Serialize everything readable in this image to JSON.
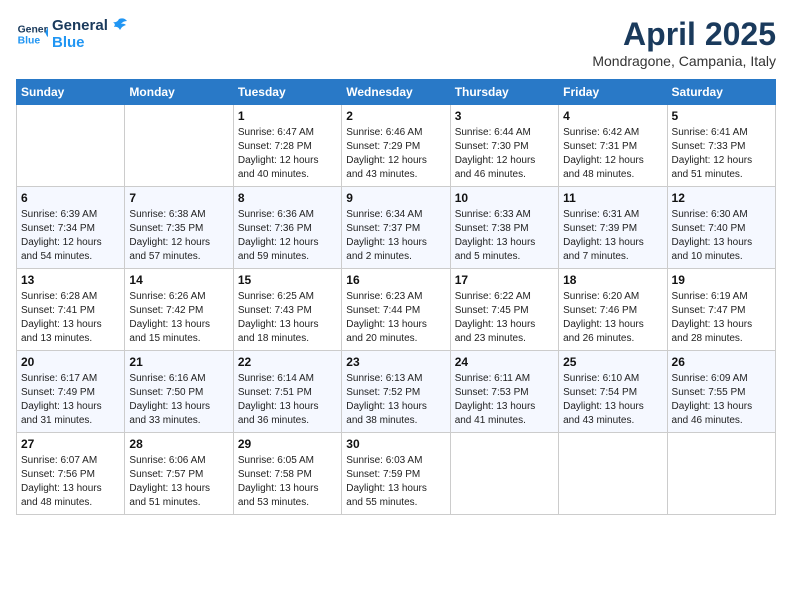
{
  "logo": {
    "line1": "General",
    "line2": "Blue"
  },
  "title": "April 2025",
  "subtitle": "Mondragone, Campania, Italy",
  "weekdays": [
    "Sunday",
    "Monday",
    "Tuesday",
    "Wednesday",
    "Thursday",
    "Friday",
    "Saturday"
  ],
  "weeks": [
    [
      {
        "day": "",
        "text": ""
      },
      {
        "day": "",
        "text": ""
      },
      {
        "day": "1",
        "text": "Sunrise: 6:47 AM\nSunset: 7:28 PM\nDaylight: 12 hours and 40 minutes."
      },
      {
        "day": "2",
        "text": "Sunrise: 6:46 AM\nSunset: 7:29 PM\nDaylight: 12 hours and 43 minutes."
      },
      {
        "day": "3",
        "text": "Sunrise: 6:44 AM\nSunset: 7:30 PM\nDaylight: 12 hours and 46 minutes."
      },
      {
        "day": "4",
        "text": "Sunrise: 6:42 AM\nSunset: 7:31 PM\nDaylight: 12 hours and 48 minutes."
      },
      {
        "day": "5",
        "text": "Sunrise: 6:41 AM\nSunset: 7:33 PM\nDaylight: 12 hours and 51 minutes."
      }
    ],
    [
      {
        "day": "6",
        "text": "Sunrise: 6:39 AM\nSunset: 7:34 PM\nDaylight: 12 hours and 54 minutes."
      },
      {
        "day": "7",
        "text": "Sunrise: 6:38 AM\nSunset: 7:35 PM\nDaylight: 12 hours and 57 minutes."
      },
      {
        "day": "8",
        "text": "Sunrise: 6:36 AM\nSunset: 7:36 PM\nDaylight: 12 hours and 59 minutes."
      },
      {
        "day": "9",
        "text": "Sunrise: 6:34 AM\nSunset: 7:37 PM\nDaylight: 13 hours and 2 minutes."
      },
      {
        "day": "10",
        "text": "Sunrise: 6:33 AM\nSunset: 7:38 PM\nDaylight: 13 hours and 5 minutes."
      },
      {
        "day": "11",
        "text": "Sunrise: 6:31 AM\nSunset: 7:39 PM\nDaylight: 13 hours and 7 minutes."
      },
      {
        "day": "12",
        "text": "Sunrise: 6:30 AM\nSunset: 7:40 PM\nDaylight: 13 hours and 10 minutes."
      }
    ],
    [
      {
        "day": "13",
        "text": "Sunrise: 6:28 AM\nSunset: 7:41 PM\nDaylight: 13 hours and 13 minutes."
      },
      {
        "day": "14",
        "text": "Sunrise: 6:26 AM\nSunset: 7:42 PM\nDaylight: 13 hours and 15 minutes."
      },
      {
        "day": "15",
        "text": "Sunrise: 6:25 AM\nSunset: 7:43 PM\nDaylight: 13 hours and 18 minutes."
      },
      {
        "day": "16",
        "text": "Sunrise: 6:23 AM\nSunset: 7:44 PM\nDaylight: 13 hours and 20 minutes."
      },
      {
        "day": "17",
        "text": "Sunrise: 6:22 AM\nSunset: 7:45 PM\nDaylight: 13 hours and 23 minutes."
      },
      {
        "day": "18",
        "text": "Sunrise: 6:20 AM\nSunset: 7:46 PM\nDaylight: 13 hours and 26 minutes."
      },
      {
        "day": "19",
        "text": "Sunrise: 6:19 AM\nSunset: 7:47 PM\nDaylight: 13 hours and 28 minutes."
      }
    ],
    [
      {
        "day": "20",
        "text": "Sunrise: 6:17 AM\nSunset: 7:49 PM\nDaylight: 13 hours and 31 minutes."
      },
      {
        "day": "21",
        "text": "Sunrise: 6:16 AM\nSunset: 7:50 PM\nDaylight: 13 hours and 33 minutes."
      },
      {
        "day": "22",
        "text": "Sunrise: 6:14 AM\nSunset: 7:51 PM\nDaylight: 13 hours and 36 minutes."
      },
      {
        "day": "23",
        "text": "Sunrise: 6:13 AM\nSunset: 7:52 PM\nDaylight: 13 hours and 38 minutes."
      },
      {
        "day": "24",
        "text": "Sunrise: 6:11 AM\nSunset: 7:53 PM\nDaylight: 13 hours and 41 minutes."
      },
      {
        "day": "25",
        "text": "Sunrise: 6:10 AM\nSunset: 7:54 PM\nDaylight: 13 hours and 43 minutes."
      },
      {
        "day": "26",
        "text": "Sunrise: 6:09 AM\nSunset: 7:55 PM\nDaylight: 13 hours and 46 minutes."
      }
    ],
    [
      {
        "day": "27",
        "text": "Sunrise: 6:07 AM\nSunset: 7:56 PM\nDaylight: 13 hours and 48 minutes."
      },
      {
        "day": "28",
        "text": "Sunrise: 6:06 AM\nSunset: 7:57 PM\nDaylight: 13 hours and 51 minutes."
      },
      {
        "day": "29",
        "text": "Sunrise: 6:05 AM\nSunset: 7:58 PM\nDaylight: 13 hours and 53 minutes."
      },
      {
        "day": "30",
        "text": "Sunrise: 6:03 AM\nSunset: 7:59 PM\nDaylight: 13 hours and 55 minutes."
      },
      {
        "day": "",
        "text": ""
      },
      {
        "day": "",
        "text": ""
      },
      {
        "day": "",
        "text": ""
      }
    ]
  ]
}
